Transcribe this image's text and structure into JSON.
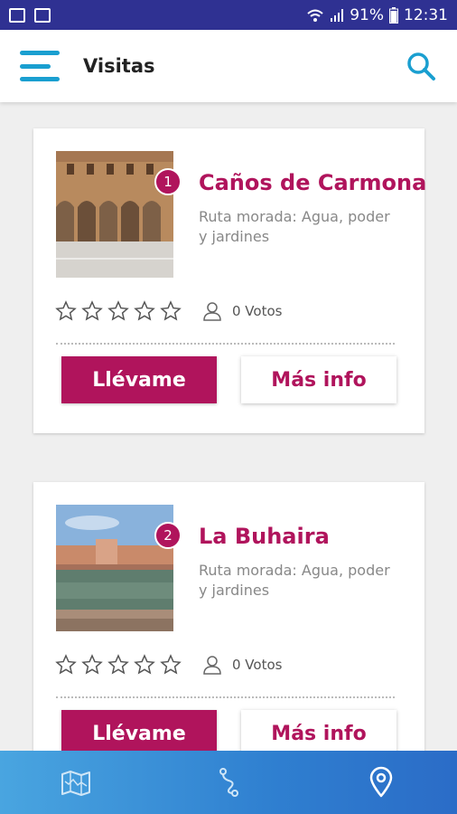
{
  "status_bar": {
    "battery": "91%",
    "time": "12:31"
  },
  "app_bar": {
    "title": "Visitas",
    "icons": [
      "menu-icon",
      "search-icon"
    ]
  },
  "cards": [
    {
      "number": "1",
      "title": "Caños de Carmona",
      "subtitle": "Ruta morada: Agua, poder y jardines",
      "rating": 0,
      "votes": "0 Votos",
      "go_label": "Llévame",
      "info_label": "Más info"
    },
    {
      "number": "2",
      "title": "La Buhaira",
      "subtitle": "Ruta morada: Agua, poder y jardines",
      "rating": 0,
      "votes": "0 Votos",
      "go_label": "Llévame",
      "info_label": "Más info"
    }
  ],
  "bottom_nav": {
    "items": [
      "map-icon",
      "route-icon",
      "location-pin-icon"
    ],
    "active": "location-pin-icon"
  },
  "colors": {
    "accent": "#b0145c",
    "status_bar": "#2f3192",
    "primary_blue": "#1a9fd0",
    "nav_gradient_start": "#49a5e0",
    "nav_gradient_end": "#2b6cc7"
  }
}
